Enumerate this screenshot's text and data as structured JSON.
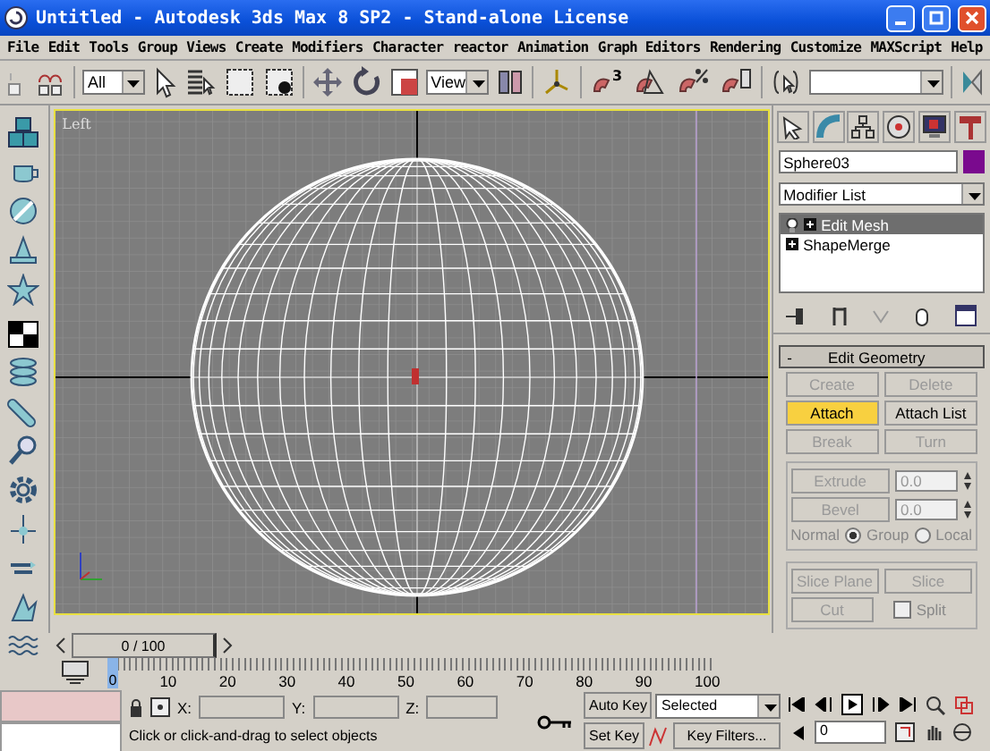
{
  "window": {
    "title": "Untitled  - Autodesk 3ds Max 8 SP2  - Stand-alone License"
  },
  "menu": [
    "File",
    "Edit",
    "Tools",
    "Group",
    "Views",
    "Create",
    "Modifiers",
    "Character",
    "reactor",
    "Animation",
    "Graph Editors",
    "Rendering",
    "Customize",
    "MAXScript",
    "Help"
  ],
  "toolbar": {
    "selection_filter": "All",
    "reference_coord": "View",
    "snap_dimension": "3"
  },
  "viewport": {
    "label": "Left"
  },
  "time_slider": {
    "position": "0 / 100"
  },
  "track_bar": {
    "current": "0",
    "ticks": [
      "10",
      "20",
      "30",
      "40",
      "50",
      "60",
      "70",
      "80",
      "90",
      "100"
    ]
  },
  "coordinates": {
    "x_label": "X:",
    "y_label": "Y:",
    "z_label": "Z:"
  },
  "prompt": "Click or click-and-drag to select objects",
  "animation": {
    "auto_key": "Auto Key",
    "set_key": "Set Key",
    "key_mode": "Selected",
    "key_filters": "Key Filters...",
    "frame": "0"
  },
  "command_panel": {
    "object": {
      "name": "Sphere03",
      "color": "#7a0a8e"
    },
    "modifier_list": "Modifier List",
    "stack": [
      {
        "label": "Edit Mesh",
        "selected": true
      },
      {
        "label": "ShapeMerge",
        "selected": false
      }
    ],
    "rollout": {
      "toggle": "-",
      "title": "Edit Geometry",
      "button_rows": [
        [
          {
            "label": "Create",
            "disabled": true,
            "active": false
          },
          {
            "label": "Delete",
            "disabled": true,
            "active": false
          }
        ],
        [
          {
            "label": "Attach",
            "disabled": false,
            "active": true
          },
          {
            "label": "Attach List",
            "disabled": false,
            "active": false
          }
        ],
        [
          {
            "label": "Break",
            "disabled": true,
            "active": false
          },
          {
            "label": "Turn",
            "disabled": true,
            "active": false
          }
        ]
      ],
      "spinners": [
        {
          "label": "Extrude",
          "value": "0.0",
          "disabled": true
        },
        {
          "label": "Bevel",
          "value": "0.0",
          "disabled": true
        }
      ],
      "normal_label": "Normal",
      "normal_options": [
        {
          "label": "Group",
          "selected": true
        },
        {
          "label": "Local",
          "selected": false
        }
      ],
      "slice_buttons": [
        {
          "label": "Slice Plane",
          "disabled": true
        },
        {
          "label": "Slice",
          "disabled": true
        }
      ],
      "cut": {
        "label": "Cut",
        "disabled": true
      },
      "split": {
        "label": "Split",
        "checked": false,
        "disabled": true
      }
    }
  }
}
